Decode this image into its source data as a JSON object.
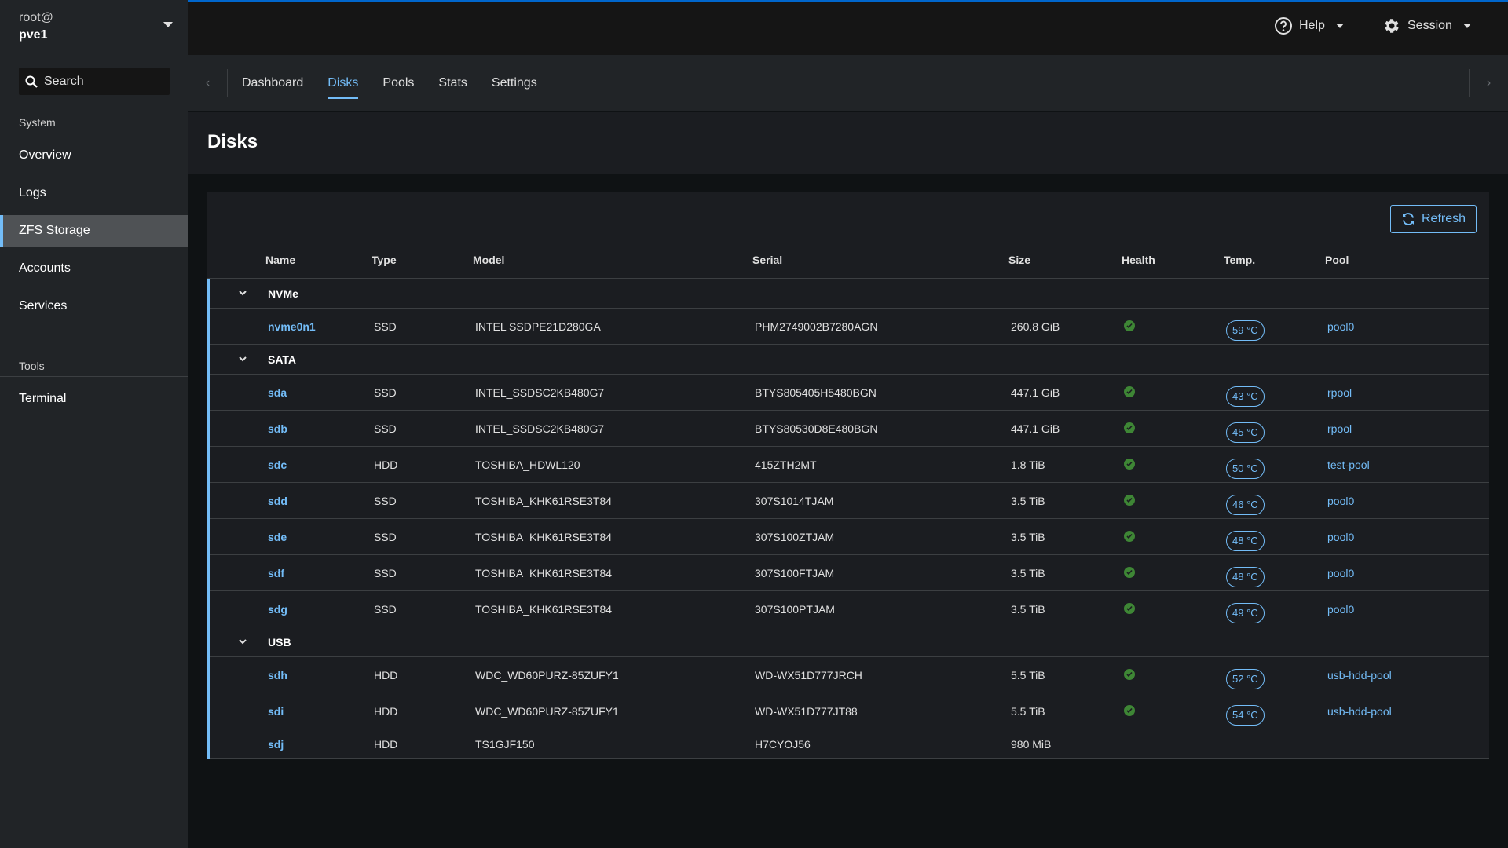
{
  "host": {
    "user": "root@",
    "name": "pve1"
  },
  "search": {
    "placeholder": "Search"
  },
  "sidebar": {
    "system_heading": "System",
    "system_items": [
      {
        "label": "Overview"
      },
      {
        "label": "Logs"
      },
      {
        "label": "ZFS Storage",
        "active": true
      },
      {
        "label": "Accounts"
      },
      {
        "label": "Services"
      }
    ],
    "tools_heading": "Tools",
    "tools_items": [
      {
        "label": "Terminal"
      }
    ]
  },
  "topbar": {
    "help_label": "Help",
    "session_label": "Session"
  },
  "tabs": [
    {
      "label": "Dashboard"
    },
    {
      "label": "Disks",
      "active": true
    },
    {
      "label": "Pools"
    },
    {
      "label": "Stats"
    },
    {
      "label": "Settings"
    }
  ],
  "page": {
    "title": "Disks"
  },
  "toolbar": {
    "refresh_label": "Refresh"
  },
  "table": {
    "columns": [
      "Name",
      "Type",
      "Model",
      "Serial",
      "Size",
      "Health",
      "Temp.",
      "Pool"
    ],
    "groups": [
      {
        "label": "NVMe",
        "rows": [
          {
            "name": "nvme0n1",
            "type": "SSD",
            "model": "INTEL SSDPE21D280GA",
            "serial": "PHM2749002B7280AGN",
            "size": "260.8 GiB",
            "healthy": true,
            "temp": "59 °C",
            "pool": "pool0"
          }
        ]
      },
      {
        "label": "SATA",
        "rows": [
          {
            "name": "sda",
            "type": "SSD",
            "model": "INTEL_SSDSC2KB480G7",
            "serial": "BTYS805405H5480BGN",
            "size": "447.1 GiB",
            "healthy": true,
            "temp": "43 °C",
            "pool": "rpool"
          },
          {
            "name": "sdb",
            "type": "SSD",
            "model": "INTEL_SSDSC2KB480G7",
            "serial": "BTYS80530D8E480BGN",
            "size": "447.1 GiB",
            "healthy": true,
            "temp": "45 °C",
            "pool": "rpool"
          },
          {
            "name": "sdc",
            "type": "HDD",
            "model": "TOSHIBA_HDWL120",
            "serial": "415ZTH2MT",
            "size": "1.8 TiB",
            "healthy": true,
            "temp": "50 °C",
            "pool": "test-pool"
          },
          {
            "name": "sdd",
            "type": "SSD",
            "model": "TOSHIBA_KHK61RSE3T84",
            "serial": "307S1014TJAM",
            "size": "3.5 TiB",
            "healthy": true,
            "temp": "46 °C",
            "pool": "pool0"
          },
          {
            "name": "sde",
            "type": "SSD",
            "model": "TOSHIBA_KHK61RSE3T84",
            "serial": "307S100ZTJAM",
            "size": "3.5 TiB",
            "healthy": true,
            "temp": "48 °C",
            "pool": "pool0"
          },
          {
            "name": "sdf",
            "type": "SSD",
            "model": "TOSHIBA_KHK61RSE3T84",
            "serial": "307S100FTJAM",
            "size": "3.5 TiB",
            "healthy": true,
            "temp": "48 °C",
            "pool": "pool0"
          },
          {
            "name": "sdg",
            "type": "SSD",
            "model": "TOSHIBA_KHK61RSE3T84",
            "serial": "307S100PTJAM",
            "size": "3.5 TiB",
            "healthy": true,
            "temp": "49 °C",
            "pool": "pool0"
          }
        ]
      },
      {
        "label": "USB",
        "rows": [
          {
            "name": "sdh",
            "type": "HDD",
            "model": "WDC_WD60PURZ-85ZUFY1",
            "serial": "WD-WX51D777JRCH",
            "size": "5.5 TiB",
            "healthy": true,
            "temp": "52 °C",
            "pool": "usb-hdd-pool"
          },
          {
            "name": "sdi",
            "type": "HDD",
            "model": "WDC_WD60PURZ-85ZUFY1",
            "serial": "WD-WX51D777JT88",
            "size": "5.5 TiB",
            "healthy": true,
            "temp": "54 °C",
            "pool": "usb-hdd-pool"
          },
          {
            "name": "sdj",
            "type": "HDD",
            "model": "TS1GJF150",
            "serial": "H7CYOJ56",
            "size": "980 MiB",
            "healthy": null,
            "temp": "",
            "pool": ""
          }
        ]
      }
    ]
  },
  "colors": {
    "accent": "#73bcf7",
    "topbar_border": "#0066cc",
    "health_ok": "#3e8635"
  },
  "icons": {
    "search": "search-icon",
    "help": "help-circle-icon",
    "session": "gear-icon",
    "refresh": "sync-icon",
    "group_toggle": "chevron-down-icon",
    "health_ok": "check-circle-icon"
  }
}
